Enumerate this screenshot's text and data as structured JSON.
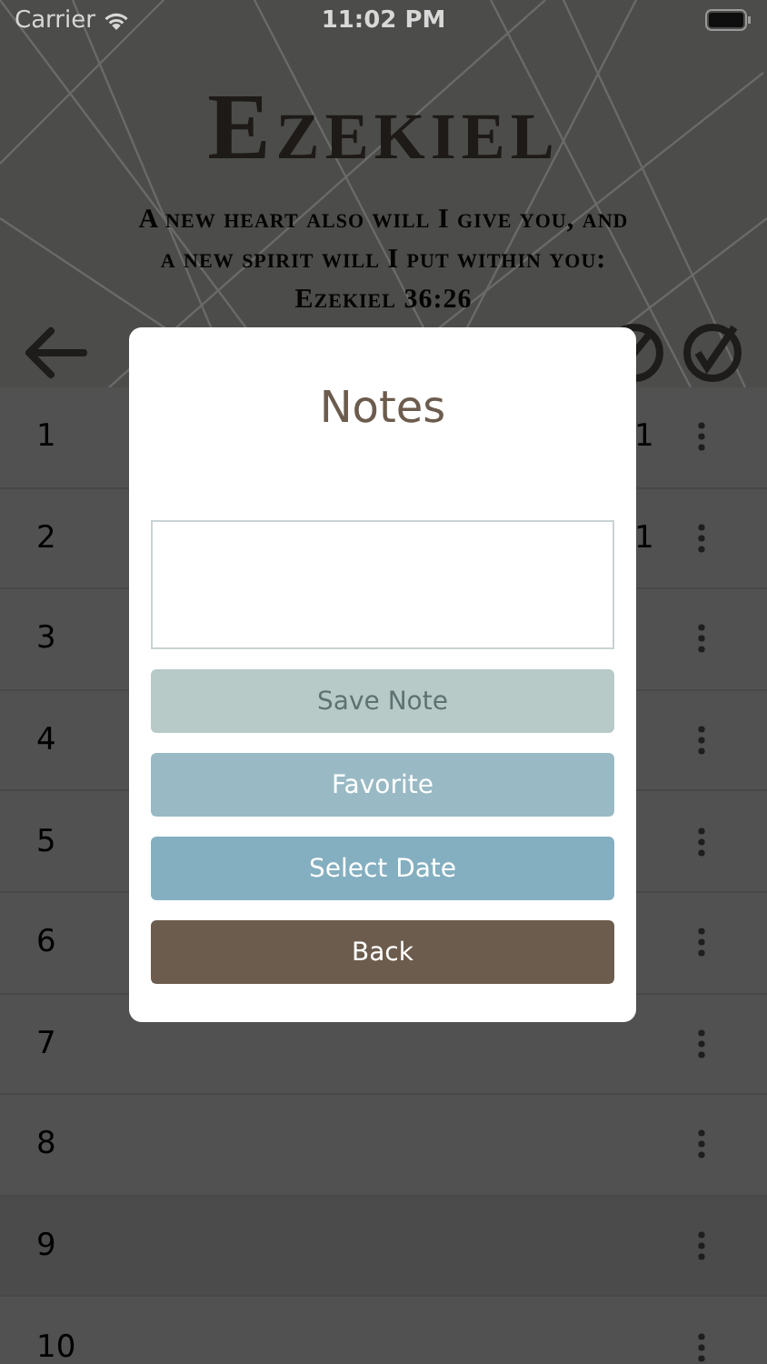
{
  "status_bar": {
    "carrier": "Carrier",
    "time": "11:02 PM"
  },
  "header": {
    "title": "Ezekiel",
    "verse_lines": [
      "A new heart also will I give you, and",
      "a new spirit will I put within you:"
    ],
    "reference": "Ezekiel 36:26"
  },
  "rows": [
    {
      "number": "1",
      "count": "1"
    },
    {
      "number": "2",
      "count": "1"
    },
    {
      "number": "3"
    },
    {
      "number": "4"
    },
    {
      "number": "5"
    },
    {
      "number": "6"
    },
    {
      "number": "7"
    },
    {
      "number": "8"
    },
    {
      "number": "9"
    },
    {
      "number": "10"
    }
  ],
  "dialog": {
    "title": "Notes",
    "buttons": [
      {
        "label": "Save Note",
        "color": "#b7cac8",
        "disabled": true
      },
      {
        "label": "Favorite",
        "color": "#99bac4",
        "disabled": false
      },
      {
        "label": "Select Date",
        "color": "#84afc0",
        "disabled": false
      },
      {
        "label": "Back",
        "color": "#6c5c4d",
        "disabled": false
      }
    ]
  }
}
